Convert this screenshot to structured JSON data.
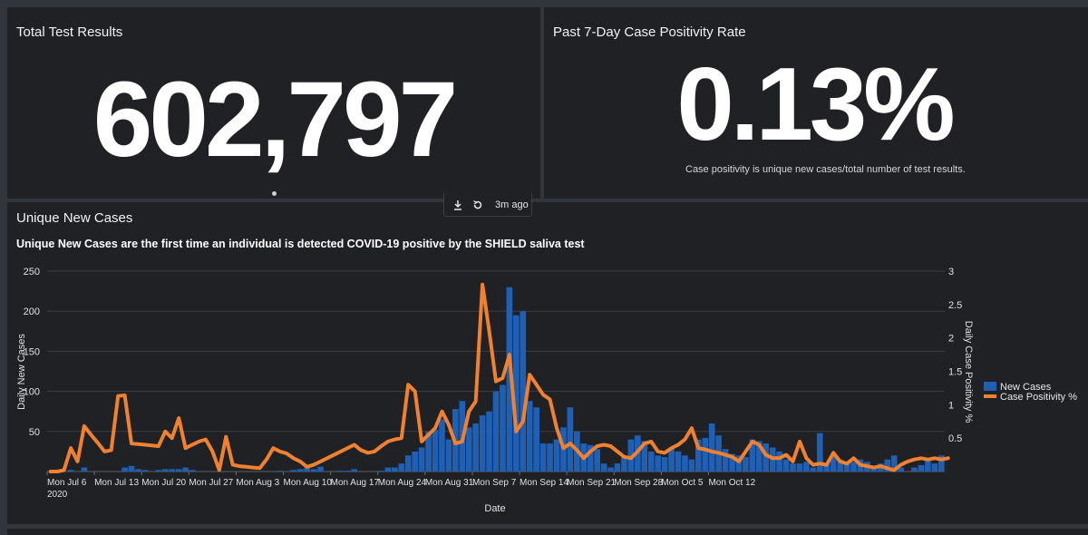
{
  "panels": {
    "total_tests": {
      "title": "Total Test Results",
      "value": "602,797"
    },
    "positivity": {
      "title": "Past 7-Day Case Positivity Rate",
      "value": "0.13%",
      "note": "Case positivity is unique new cases/total number of test results."
    },
    "unique_cases": {
      "title": "Unique New Cases",
      "subtitle": "Unique New Cases are the first time an individual is detected COVID-19 positive by the SHIELD saliva test",
      "toolbar": {
        "download_icon": "download-icon",
        "refresh_icon": "refresh-icon",
        "last_updated": "3m ago"
      }
    }
  },
  "colors": {
    "bar": "#1f5fb4",
    "line": "#f0812e",
    "panel": "#1f2125",
    "background": "#31353c",
    "grid": "#3a3d42"
  },
  "chart_data": {
    "type": "bar",
    "xlabel": "Date",
    "ylabel": "Daily New Cases",
    "y2label": "Daily Case Positivity %",
    "ylim": [
      0,
      250
    ],
    "y2lim": [
      0,
      3
    ],
    "yticks": [
      "250",
      "200",
      "150",
      "100",
      "50"
    ],
    "y2ticks": [
      "3",
      "2.5",
      "2",
      "1.5",
      "1",
      "0.5"
    ],
    "xticks": [
      "Mon Jul 6",
      "Mon Jul 13",
      "Mon Jul 20",
      "Mon Jul 27",
      "Mon Aug 3",
      "Mon Aug 10",
      "Mon Aug 17",
      "Mon Aug 24",
      "Mon Aug 31",
      "Mon Sep 7",
      "Mon Sep 14",
      "Mon Sep 21",
      "Mon Sep 28",
      "Mon Oct 5",
      "Mon Oct 12"
    ],
    "xtick_sub": "2020",
    "grid": true,
    "legend_position": "right",
    "series": [
      {
        "name": "New Cases",
        "axis": "left",
        "color": "#1f5fb4",
        "values": [
          0,
          0,
          0,
          2,
          0,
          5,
          0,
          0,
          0,
          0,
          0,
          5,
          7,
          3,
          2,
          0,
          2,
          3,
          3,
          3,
          5,
          2,
          0,
          0,
          0,
          0,
          0,
          0,
          0,
          0,
          0,
          0,
          0,
          0,
          1,
          0,
          2,
          3,
          5,
          3,
          6,
          0,
          0,
          1,
          1,
          3,
          0,
          0,
          0,
          1,
          5,
          5,
          10,
          20,
          25,
          30,
          50,
          52,
          65,
          40,
          78,
          88,
          55,
          60,
          70,
          75,
          100,
          108,
          230,
          195,
          200,
          88,
          80,
          35,
          35,
          40,
          55,
          80,
          50,
          35,
          33,
          28,
          10,
          5,
          10,
          20,
          40,
          45,
          38,
          25,
          20,
          18,
          30,
          25,
          20,
          15,
          40,
          42,
          60,
          45,
          28,
          22,
          20,
          18,
          40,
          38,
          35,
          30,
          25,
          15,
          10,
          10,
          12,
          5,
          48,
          10,
          20,
          15,
          10,
          12,
          15,
          12,
          5,
          10,
          15,
          20,
          5,
          0,
          5,
          8,
          15,
          10,
          20
        ]
      },
      {
        "name": "Case Positivity %",
        "axis": "right",
        "color": "#f0812e",
        "values": [
          0,
          0,
          0.02,
          0.35,
          0.15,
          0.68,
          0.55,
          0.43,
          0.3,
          0.32,
          1.13,
          1.14,
          0.42,
          0.41,
          0.4,
          0.39,
          0.38,
          0.6,
          0.5,
          0.8,
          0.35,
          0.4,
          0.45,
          0.48,
          0.3,
          0.02,
          0.52,
          0.1,
          0.08,
          0.07,
          0.06,
          0.05,
          0.18,
          0.35,
          0.3,
          0.27,
          0.2,
          0.15,
          0.07,
          0.1,
          0.15,
          0.2,
          0.25,
          0.3,
          0.35,
          0.4,
          0.32,
          0.28,
          0.3,
          0.38,
          0.45,
          0.48,
          0.5,
          1.3,
          1.2,
          0.45,
          0.55,
          0.65,
          0.9,
          0.7,
          0.42,
          0.45,
          0.9,
          1.05,
          2.8,
          2.1,
          1.35,
          1.4,
          1.75,
          0.6,
          0.75,
          1.45,
          1.3,
          1.15,
          1.08,
          0.65,
          0.35,
          0.42,
          0.32,
          0.2,
          0.3,
          0.38,
          0.4,
          0.38,
          0.3,
          0.22,
          0.2,
          0.3,
          0.42,
          0.45,
          0.3,
          0.28,
          0.35,
          0.4,
          0.48,
          0.65,
          0.35,
          0.33,
          0.3,
          0.28,
          0.25,
          0.22,
          0.15,
          0.3,
          0.45,
          0.4,
          0.25,
          0.2,
          0.2,
          0.25,
          0.15,
          0.45,
          0.2,
          0.1,
          0.12,
          0.1,
          0.28,
          0.15,
          0.12,
          0.2,
          0.1,
          0.08,
          0.06,
          0.08,
          0.05,
          0.02,
          0.1,
          0.15,
          0.18,
          0.2,
          0.18,
          0.2,
          0.18,
          0.2
        ]
      }
    ]
  }
}
